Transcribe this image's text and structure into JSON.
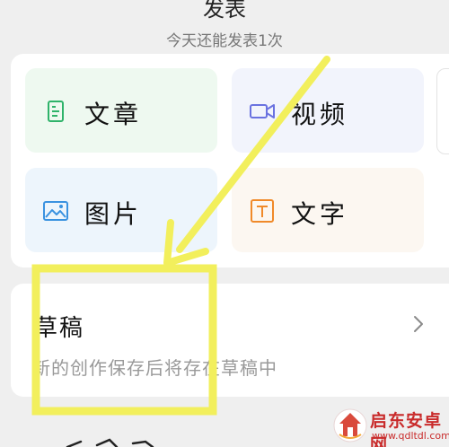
{
  "header": {
    "title": "发表",
    "subtitle": "今天还能发表1次"
  },
  "options": [
    {
      "id": "article",
      "label": "文章",
      "icon": "document-icon",
      "color": "#2fb36a"
    },
    {
      "id": "video",
      "label": "视频",
      "icon": "video-camera-icon",
      "color": "#6a72e0"
    },
    {
      "id": "image",
      "label": "图片",
      "icon": "image-icon",
      "color": "#3a92e0"
    },
    {
      "id": "text",
      "label": "文字",
      "icon": "text-t-icon",
      "color": "#f08a2a"
    }
  ],
  "drafts": {
    "title": "草稿",
    "description": "新的创作保存后将存在草稿中",
    "icon": "chevron-right-icon"
  },
  "watermark": {
    "name": "启东安卓网",
    "url": "www.qdltdl.com",
    "brand_color": "#c92b2b"
  },
  "annotation": {
    "color": "#f2ef5c"
  }
}
